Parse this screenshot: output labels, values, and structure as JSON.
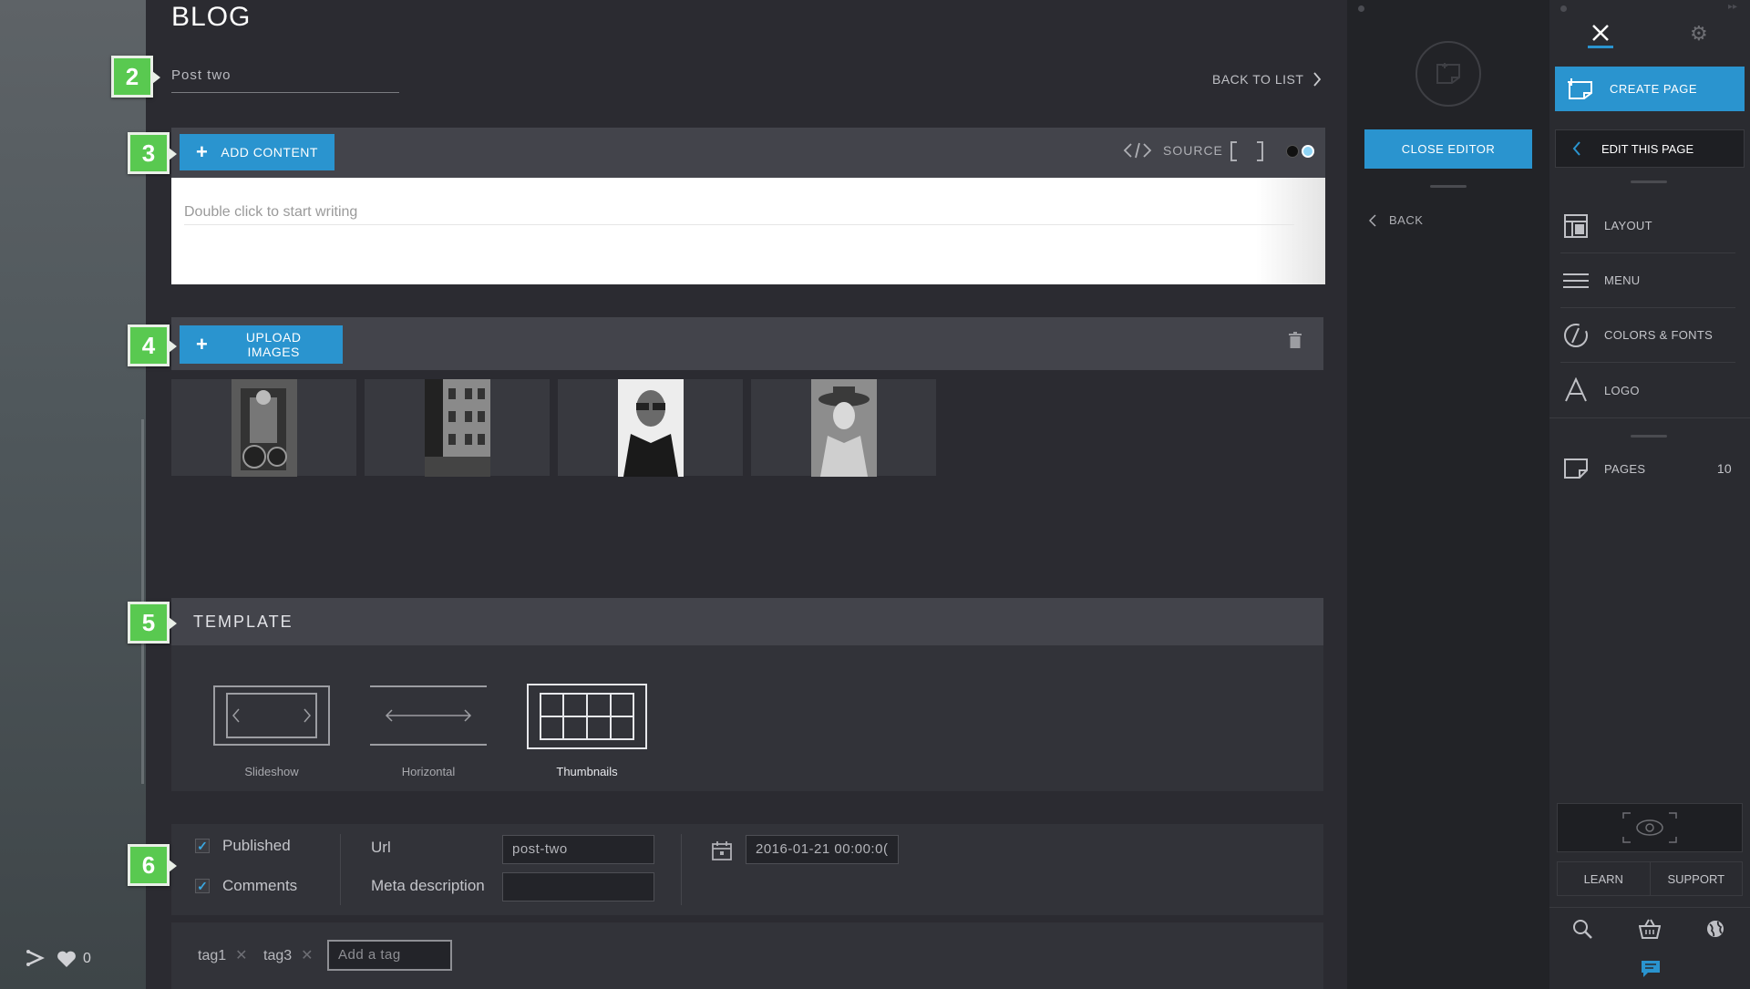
{
  "page": {
    "title": "BLOG",
    "post_title": "Post two",
    "back_to_list": "BACK TO LIST"
  },
  "badges": [
    "2",
    "3",
    "4",
    "5",
    "6"
  ],
  "content": {
    "add_content": "ADD CONTENT",
    "source": "SOURCE",
    "placeholder": "Double click to start writing"
  },
  "images": {
    "upload": "UPLOAD IMAGES",
    "thumbs": [
      {
        "alt": "motorcycle-photo"
      },
      {
        "alt": "building-photo"
      },
      {
        "alt": "man-sunglasses-photo"
      },
      {
        "alt": "woman-hat-photo"
      }
    ]
  },
  "template": {
    "title": "TEMPLATE",
    "options": [
      {
        "label": "Slideshow",
        "selected": false
      },
      {
        "label": "Horizontal",
        "selected": false
      },
      {
        "label": "Thumbnails",
        "selected": true
      }
    ]
  },
  "settings": {
    "published": "Published",
    "comments": "Comments",
    "url_label": "Url",
    "url_value": "post-two",
    "meta_label": "Meta description",
    "meta_value": "",
    "date_value": "2016-01-21 00:00:0("
  },
  "tags": {
    "items": [
      "tag1",
      "tag3"
    ],
    "placeholder": "Add a tag"
  },
  "social": {
    "likes": "0"
  },
  "mid": {
    "close_editor": "CLOSE EDITOR",
    "back": "BACK"
  },
  "right": {
    "create_page": "CREATE PAGE",
    "edit_this_page": "EDIT THIS PAGE",
    "menu_items": [
      "LAYOUT",
      "MENU",
      "COLORS & FONTS",
      "LOGO"
    ],
    "pages_label": "PAGES",
    "pages_count": "10",
    "learn": "LEARN",
    "support": "SUPPORT"
  },
  "colors": {
    "accent": "#2a94cf",
    "badge": "#59c950",
    "background": "#2b2b31"
  }
}
